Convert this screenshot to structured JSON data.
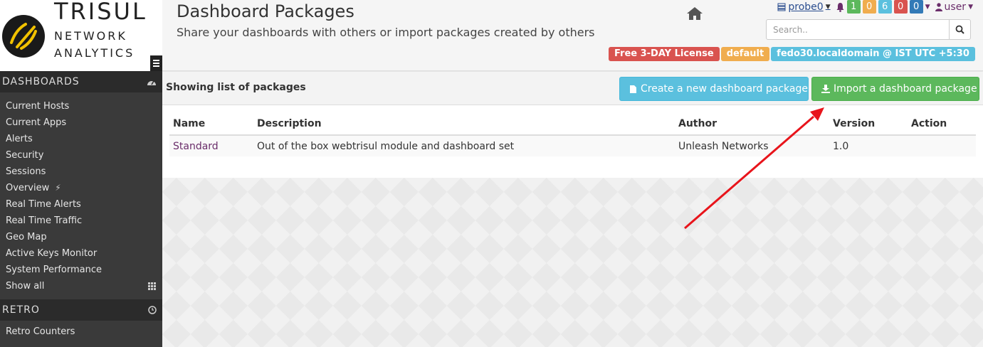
{
  "brand": {
    "title": "TRISUL",
    "sub1": "NETWORK",
    "sub2": "ANALYTICS",
    "logo_icon": "trisul-logo-icon",
    "accent": "#f2c200"
  },
  "sidebar": {
    "dashboards_header": "DASHBOARDS",
    "dashboards_icon": "tachometer-icon",
    "items": [
      {
        "label": "Current Hosts"
      },
      {
        "label": "Current Apps"
      },
      {
        "label": "Alerts"
      },
      {
        "label": "Security"
      },
      {
        "label": "Sessions"
      },
      {
        "label": "Overview",
        "icon": "bolt-icon"
      },
      {
        "label": "Real Time Alerts"
      },
      {
        "label": "Real Time Traffic"
      },
      {
        "label": "Geo Map"
      },
      {
        "label": "Active Keys Monitor"
      },
      {
        "label": "System Performance"
      },
      {
        "label": "Show all",
        "icon": "grid-icon"
      }
    ],
    "retro_header": "RETRO",
    "retro_icon": "clock-icon",
    "retro_items": [
      {
        "label": "Retro Counters"
      }
    ]
  },
  "header": {
    "title": "Dashboard Packages",
    "subtitle": "Share your dashboards with others or import packages created by others",
    "home_icon": "home-icon"
  },
  "topnav": {
    "probe": "probe0",
    "counts": [
      {
        "value": "1",
        "color": "#5cb85c"
      },
      {
        "value": "0",
        "color": "#f0ad4e"
      },
      {
        "value": "6",
        "color": "#5bc0de"
      },
      {
        "value": "0",
        "color": "#d9534f"
      },
      {
        "value": "0",
        "color": "#337ab7"
      }
    ],
    "user": "user"
  },
  "search": {
    "placeholder": "Search.."
  },
  "tags": [
    {
      "label": "Free 3-DAY License",
      "color": "#d9534f"
    },
    {
      "label": "default",
      "color": "#f0ad4e"
    },
    {
      "label": "fedo30.localdomain @ IST UTC +5:30",
      "color": "#5bc0de"
    }
  ],
  "panel": {
    "title": "Showing list of packages",
    "create_label": "Create a new dashboard package",
    "import_label": "Import a dashboard package",
    "columns": [
      "Name",
      "Description",
      "Author",
      "Version",
      "Action"
    ],
    "rows": [
      {
        "name": "Standard",
        "description": "Out of the box webtrisul module and dashboard set",
        "author": "Unleash Networks",
        "version": "1.0",
        "action": ""
      }
    ]
  },
  "annotation": {
    "arrow_color": "#e8141b"
  }
}
